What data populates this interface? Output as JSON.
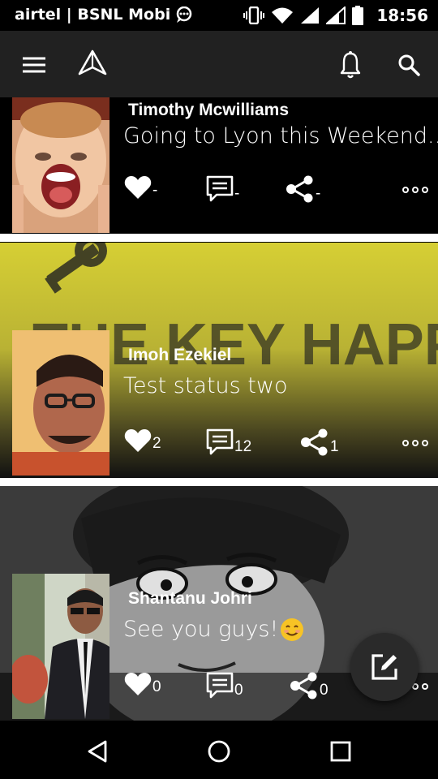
{
  "status_bar": {
    "carrier": "airtel | BSNL Mobi",
    "time": "18:56",
    "icons": [
      "chat-notification-icon",
      "vibrate-icon",
      "wifi-icon",
      "signal-icon",
      "signal-icon-2",
      "battery-icon"
    ]
  },
  "app_bar": {
    "icons": [
      "menu-icon",
      "app-logo-icon",
      "notifications-bell-icon",
      "search-icon"
    ]
  },
  "posts": [
    {
      "author": "Timothy Mcwilliams",
      "status": "Going to Lyon this Weekend....",
      "likes": "-",
      "comments": "-",
      "shares": "-",
      "background": "#000000"
    },
    {
      "author": "Imoh Ezekiel",
      "status": "Test status two",
      "likes": "2",
      "comments": "12",
      "shares": "1",
      "background_text": "THE KEY HAPPINESS",
      "background": "#c9c22c"
    },
    {
      "author": "Shantanu Johri",
      "status": "See you guys!",
      "emoji": "😊",
      "likes": "0",
      "comments": "0",
      "shares": "0",
      "background": "#3a3a3a"
    }
  ],
  "fab": {
    "icon": "compose-icon"
  },
  "nav_bar": {
    "icons": [
      "back-icon",
      "home-icon",
      "recents-icon"
    ]
  }
}
